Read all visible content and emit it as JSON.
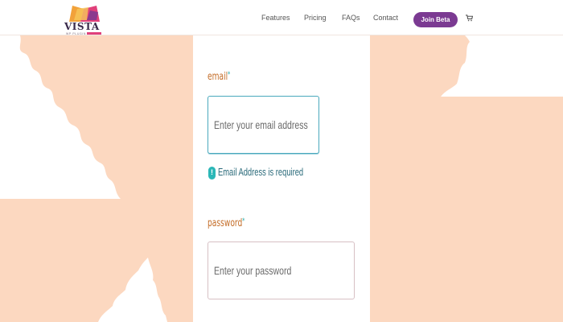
{
  "brand": {
    "name": "VISTA",
    "tagline": "WP PLUGIN",
    "colors": {
      "primary": "#7b3a92",
      "accent": "#e0407a",
      "background": "#fcd8c0"
    }
  },
  "nav": {
    "items": [
      {
        "label": "Features"
      },
      {
        "label": "Pricing"
      },
      {
        "label": "FAQs"
      },
      {
        "label": "Contact"
      }
    ],
    "cta_label": "Join Beta",
    "cart_icon": "cart-icon"
  },
  "form": {
    "email_label": "email",
    "email_placeholder": "Enter your email address",
    "email_error": "Email Address is required",
    "password_label": "password",
    "password_placeholder": "Enter your password",
    "required_mark": "*"
  }
}
